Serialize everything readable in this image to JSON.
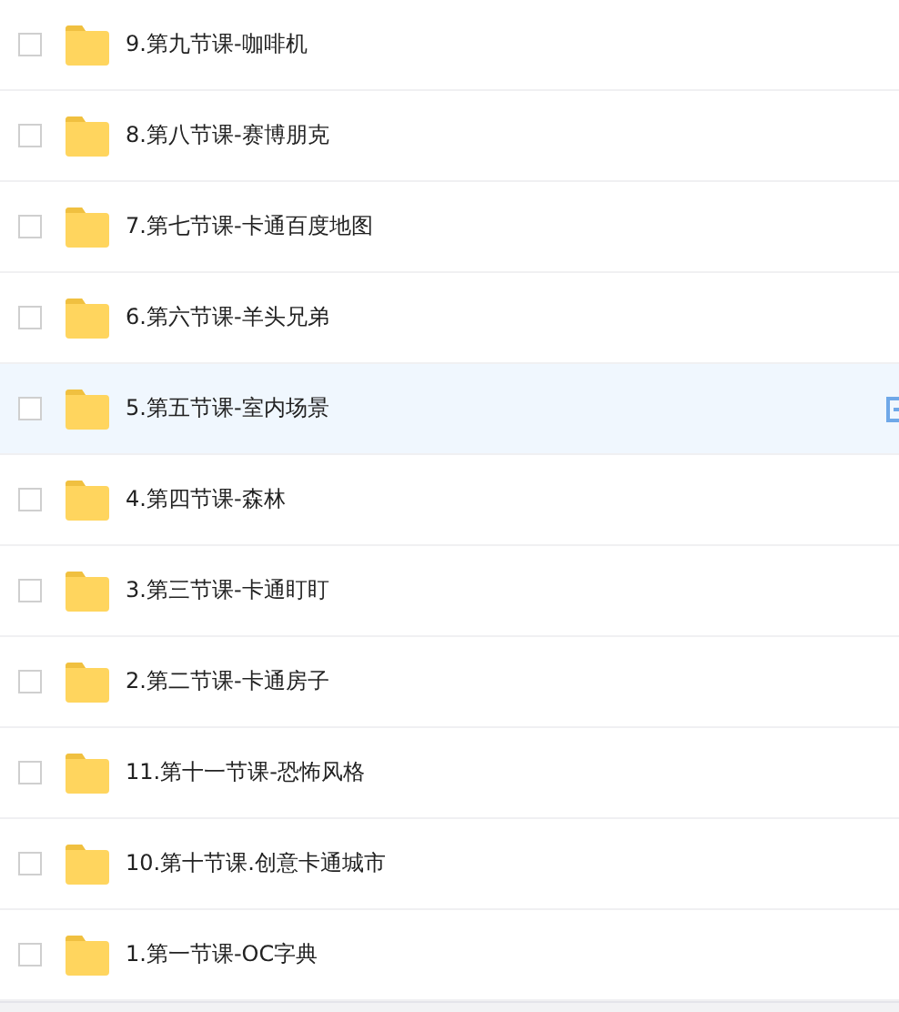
{
  "files": [
    {
      "name": "9.第九节课-咖啡机",
      "checked": false,
      "hovered": false
    },
    {
      "name": "8.第八节课-赛博朋克",
      "checked": false,
      "hovered": false
    },
    {
      "name": "7.第七节课-卡通百度地图",
      "checked": false,
      "hovered": false
    },
    {
      "name": "6.第六节课-羊头兄弟",
      "checked": false,
      "hovered": false
    },
    {
      "name": "5.第五节课-室内场景",
      "checked": false,
      "hovered": true
    },
    {
      "name": "4.第四节课-森林",
      "checked": false,
      "hovered": false
    },
    {
      "name": "3.第三节课-卡通盯盯",
      "checked": false,
      "hovered": false
    },
    {
      "name": "2.第二节课-卡通房子",
      "checked": false,
      "hovered": false
    },
    {
      "name": "11.第十一节课-恐怖风格",
      "checked": false,
      "hovered": false
    },
    {
      "name": "10.第十节课.创意卡通城市",
      "checked": false,
      "hovered": false
    },
    {
      "name": "1.第一节课-OC字典",
      "checked": false,
      "hovered": false
    }
  ]
}
